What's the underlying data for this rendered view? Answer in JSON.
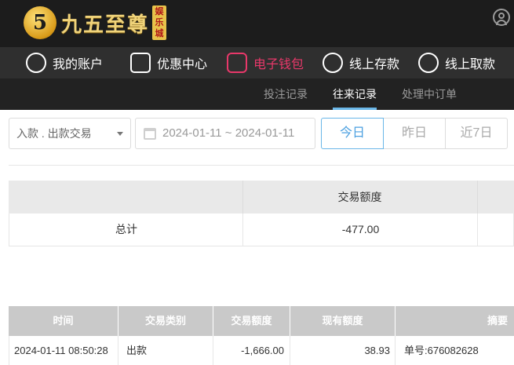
{
  "header": {
    "brand_name": "九五至尊",
    "brand_badge": "娱乐城",
    "brand_mark": "5",
    "user_icon": "user-circle-icon"
  },
  "main_nav": {
    "items": [
      {
        "label": "我的账户",
        "icon": "user-icon",
        "active": false
      },
      {
        "label": "优惠中心",
        "icon": "gift-icon",
        "active": false
      },
      {
        "label": "电子钱包",
        "icon": "wallet-icon",
        "active": true
      },
      {
        "label": "线上存款",
        "icon": "deposit-icon",
        "active": false
      },
      {
        "label": "线上取款",
        "icon": "withdraw-icon",
        "active": false
      }
    ],
    "active_color": "#e8386a"
  },
  "sub_nav": {
    "items": [
      {
        "label": "投注记录",
        "active": false
      },
      {
        "label": "往来记录",
        "active": true
      },
      {
        "label": "处理中订单",
        "active": false
      }
    ]
  },
  "filters": {
    "type_select": "入款 . 出款交易",
    "date_range": "2024-01-11 ~ 2024-01-11",
    "quick_buttons": [
      {
        "label": "今日",
        "active": true
      },
      {
        "label": "昨日",
        "active": false
      },
      {
        "label": "近7日",
        "active": false
      }
    ]
  },
  "summary": {
    "header": "交易额度",
    "row_label": "总计",
    "total": "-477.00"
  },
  "details": {
    "columns": [
      "时间",
      "交易类别",
      "交易额度",
      "现有额度",
      "摘要"
    ],
    "rows": [
      {
        "time": "2024-01-11 08:50:28",
        "type": "出款",
        "amount": "-1,666.00",
        "balance": "38.93",
        "note": "单号:676082628"
      }
    ]
  }
}
